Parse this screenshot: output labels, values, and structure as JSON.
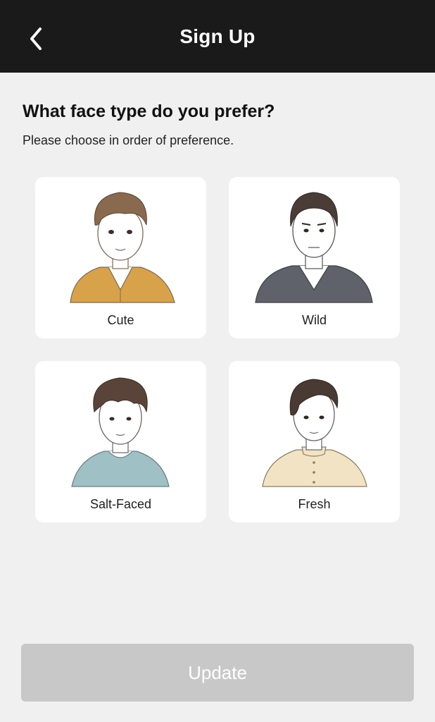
{
  "header": {
    "title": "Sign Up",
    "back_icon": "chevron-left-icon"
  },
  "question": {
    "title": "What face type do you prefer?",
    "subtitle": "Please choose in order of preference."
  },
  "options": [
    {
      "label": "Cute",
      "shirt_color": "#d8a24a",
      "hair_color": "#8a6a4f"
    },
    {
      "label": "Wild",
      "shirt_color": "#5f626b",
      "hair_color": "#4a3d38"
    },
    {
      "label": "Salt-Faced",
      "shirt_color": "#9fc0c4",
      "hair_color": "#5a4439"
    },
    {
      "label": "Fresh",
      "shirt_color": "#f1e3c3",
      "hair_color": "#4a3a34"
    }
  ],
  "update_button": {
    "label": "Update",
    "disabled_color": "#c8c8c8"
  }
}
